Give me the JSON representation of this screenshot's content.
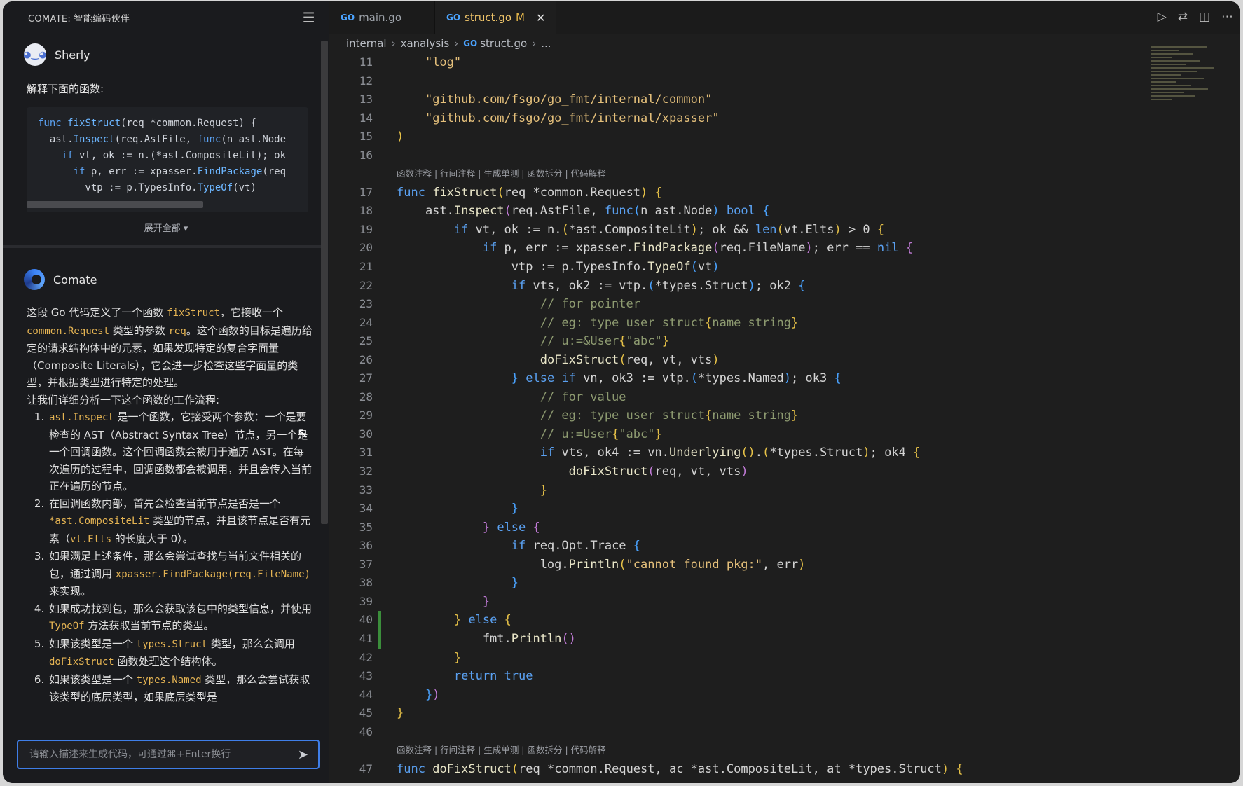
{
  "chat": {
    "title": "COMATE: 智能编码伙伴",
    "user": {
      "name": "Sherly",
      "prompt": "解释下面的函数:"
    },
    "snippet_lines": [
      "func fixStruct(req *common.Request) {",
      "  ast.Inspect(req.AstFile, func(n ast.Node",
      "    if vt, ok := n.(*ast.CompositeLit); ok",
      "      if p, err := xpasser.FindPackage(req",
      "        vtp := p.TypesInfo.TypeOf(vt)"
    ],
    "expand_label": "展开全部 ▾",
    "bot": {
      "name": "Comate"
    },
    "answer": {
      "intro_parts": [
        "这段 Go 代码定义了一个函数 ",
        "fixStruct",
        "，它接收一个 ",
        "common.Request",
        " 类型的参数 ",
        "req",
        "。这个函数的目标是遍历给定的请求结构体中的元素，如果发现特定的复合字面量（Composite Literals），它会进一步检查这些字面量的类型，并根据类型进行特定的处理。"
      ],
      "lead": "让我们详细分析一下这个函数的工作流程:",
      "steps": [
        [
          "",
          "ast.Inspect",
          " 是一个函数，它接受两个参数：一个是要检查的 AST（Abstract Syntax Tree）节点，另一个是一个回调函数。这个回调函数会被用于遍历 AST。在每次遍历的过程中，回调函数都会被调用，并且会传入当前正在遍历的节点。"
        ],
        [
          "在回调函数内部，首先会检查当前节点是否是一个 ",
          "*ast.CompositeLit",
          " 类型的节点，并且该节点是否有元素（",
          "vt.Elts",
          " 的长度大于 0）。"
        ],
        [
          "如果满足上述条件，那么会尝试查找与当前文件相关的包，通过调用 ",
          "xpasser.FindPackage(req.FileName)",
          " 来实现。"
        ],
        [
          "如果成功找到包，那么会获取该包中的类型信息，并使用 ",
          "TypeOf",
          " 方法获取当前节点的类型。"
        ],
        [
          "如果该类型是一个 ",
          "types.Struct",
          " 类型，那么会调用 ",
          "doFixStruct",
          " 函数处理这个结构体。"
        ],
        [
          "如果该类型是一个 ",
          "types.Named",
          " 类型，那么会尝试获取该类型的底层类型，如果底层类型是"
        ]
      ]
    },
    "input_placeholder": "请输入描述来生成代码，可通过⌘+Enter换行",
    "icons": {
      "menu": "list-icon",
      "send": "send-icon"
    }
  },
  "editor": {
    "tabs": [
      {
        "label": "main.go",
        "active": false
      },
      {
        "label": "struct.go",
        "modified": "M",
        "active": true
      }
    ],
    "breadcrumb": [
      "internal",
      "xanalysis",
      "struct.go",
      "..."
    ],
    "codelens": "函数注释 | 行间注释 | 生成单测 | 函数拆分 | 代码解释",
    "lines": [
      {
        "n": "11",
        "html": "    <span class='strl'>\"log\"</span>"
      },
      {
        "n": "12",
        "html": ""
      },
      {
        "n": "13",
        "html": "    <span class='strl'>\"github.com/fsgo/go_fmt/internal/common\"</span>"
      },
      {
        "n": "14",
        "html": "    <span class='strl'>\"github.com/fsgo/go_fmt/internal/xpasser\"</span>"
      },
      {
        "n": "15",
        "html": "<span class='br1'>)</span>"
      },
      {
        "n": "16",
        "html": ""
      },
      {
        "lens": true
      },
      {
        "n": "17",
        "html": "<span class='kw'>func</span> <span class='fn'>fixStruct</span><span class='br1'>(</span>req *common.Request<span class='br1'>)</span> <span class='br1'>{</span>"
      },
      {
        "n": "18",
        "html": "    ast.<span class='fn'>Inspect</span><span class='br3'>(</span>req.AstFile, <span class='kw'>func</span><span class='br2'>(</span>n ast.Node<span class='br2'>)</span> <span class='kw'>bool</span> <span class='br2'>{</span>"
      },
      {
        "n": "19",
        "html": "        <span class='kw'>if</span> vt, ok := n.<span class='br1'>(</span>*ast.CompositeLit<span class='br1'>)</span>; ok &amp;&amp; <span class='kw'>len</span><span class='br1'>(</span>vt.Elts<span class='br1'>)</span> &gt; 0 <span class='br1'>{</span>"
      },
      {
        "n": "20",
        "html": "            <span class='kw'>if</span> p, err := xpasser.<span class='fn'>FindPackage</span><span class='br3'>(</span>req.FileName<span class='br3'>)</span>; err == <span class='kw'>nil</span> <span class='br3'>{</span>"
      },
      {
        "n": "21",
        "html": "                vtp := p.TypesInfo.<span class='fn'>TypeOf</span><span class='br2'>(</span>vt<span class='br2'>)</span>"
      },
      {
        "n": "22",
        "html": "                <span class='kw'>if</span> vts, ok2 := vtp.<span class='br2'>(</span>*types.Struct<span class='br2'>)</span>; ok2 <span class='br2'>{</span>"
      },
      {
        "n": "23",
        "html": "                    <span class='cm'>// for pointer</span>"
      },
      {
        "n": "24",
        "html": "                    <span class='cm'>// eg: type user struct</span><span class='br1'>{</span><span class='cm'>name string</span><span class='br1'>}</span>"
      },
      {
        "n": "25",
        "html": "                    <span class='cm'>// u:=&amp;User</span><span class='br1'>{</span><span class='cm'>\"abc\"</span><span class='br1'>}</span>"
      },
      {
        "n": "26",
        "html": "                    <span class='fn'>doFixStruct</span><span class='br1'>(</span>req, vt, vts<span class='br1'>)</span>"
      },
      {
        "n": "27",
        "html": "                <span class='br2'>}</span> <span class='kw'>else</span> <span class='kw'>if</span> vn, ok3 := vtp.<span class='br2'>(</span>*types.Named<span class='br2'>)</span>; ok3 <span class='br2'>{</span>"
      },
      {
        "n": "28",
        "html": "                    <span class='cm'>// for value</span>"
      },
      {
        "n": "29",
        "html": "                    <span class='cm'>// eg: type user struct</span><span class='br1'>{</span><span class='cm'>name string</span><span class='br1'>}</span>"
      },
      {
        "n": "30",
        "html": "                    <span class='cm'>// u:=User</span><span class='br1'>{</span><span class='cm'>\"abc\"</span><span class='br1'>}</span>"
      },
      {
        "n": "31",
        "html": "                    <span class='kw'>if</span> vts, ok4 := vn.<span class='fn'>Underlying</span><span class='br1'>()</span>.<span class='br1'>(</span>*types.Struct<span class='br1'>)</span>; ok4 <span class='br1'>{</span>"
      },
      {
        "n": "32",
        "html": "                        <span class='fn'>doFixStruct</span><span class='br3'>(</span>req, vt, vts<span class='br3'>)</span>"
      },
      {
        "n": "33",
        "html": "                    <span class='br1'>}</span>"
      },
      {
        "n": "34",
        "html": "                <span class='br2'>}</span>"
      },
      {
        "n": "35",
        "html": "            <span class='br3'>}</span> <span class='kw'>else</span> <span class='br3'>{</span>"
      },
      {
        "n": "36",
        "html": "                <span class='kw'>if</span> req.Opt.Trace <span class='br2'>{</span>"
      },
      {
        "n": "37",
        "html": "                    log.<span class='fn'>Println</span><span class='br1'>(</span><span class='str'>\"cannot found pkg:\"</span>, err<span class='br1'>)</span>"
      },
      {
        "n": "38",
        "html": "                <span class='br2'>}</span>"
      },
      {
        "n": "39",
        "html": "            <span class='br3'>}</span>"
      },
      {
        "n": "40",
        "html": "        <span class='br1'>}</span> <span class='kw'>else</span> <span class='br1'>{</span>"
      },
      {
        "n": "41",
        "html": "            fmt.<span class='fn'>Println</span><span class='br3'>()</span>"
      },
      {
        "n": "42",
        "html": "        <span class='br1'>}</span>"
      },
      {
        "n": "43",
        "html": "        <span class='kw'>return</span> <span class='bool'>true</span>"
      },
      {
        "n": "44",
        "html": "    <span class='br2'>}</span><span class='br3'>)</span>"
      },
      {
        "n": "45",
        "html": "<span class='br1'>}</span>"
      },
      {
        "n": "46",
        "html": ""
      },
      {
        "lens": true
      },
      {
        "n": "47",
        "html": "<span class='kw'>func</span> <span class='fn'>doFixStruct</span><span class='br1'>(</span>req *common.Request, ac *ast.CompositeLit, at *types.Struct<span class='br1'>)</span> <span class='br1'>{</span>"
      }
    ],
    "git_modified_lines": [
      "40",
      "41"
    ],
    "actions": [
      "run-icon",
      "source-control-icon",
      "split-editor-icon",
      "more-icon"
    ]
  }
}
